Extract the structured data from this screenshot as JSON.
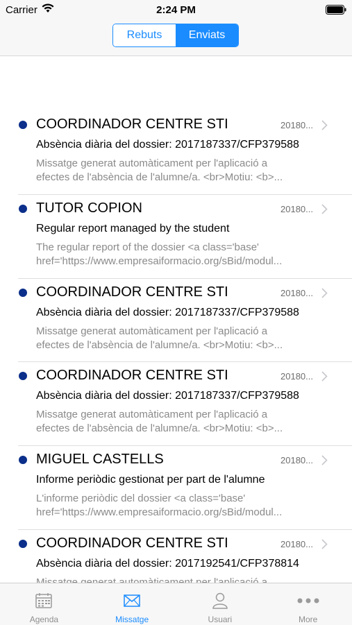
{
  "status_bar": {
    "carrier": "Carrier",
    "time": "2:24 PM"
  },
  "segments": [
    {
      "label": "Rebuts",
      "active": false
    },
    {
      "label": "Enviats",
      "active": true
    }
  ],
  "messages": [
    {
      "sender": "COORDINADOR CENTRE STI",
      "date": "20180...",
      "subject": "Absència diària del dossier: 2017187337/CFP379588",
      "preview_line1": "Missatge generat automàticament per l'aplicació a",
      "preview_line2": "efectes de l'absència de l'alumne/a. <br>Motiu: <b>..."
    },
    {
      "sender": "TUTOR COPION",
      "date": "20180...",
      "subject": "Regular report managed by the student",
      "preview_line1": "The regular report of the dossier <a class='base'",
      "preview_line2": "href='https://www.empresaiformacio.org/sBid/modul..."
    },
    {
      "sender": "COORDINADOR CENTRE STI",
      "date": "20180...",
      "subject": "Absència diària del dossier: 2017187337/CFP379588",
      "preview_line1": "Missatge generat automàticament per l'aplicació a",
      "preview_line2": "efectes de l'absència de l'alumne/a. <br>Motiu: <b>..."
    },
    {
      "sender": "COORDINADOR CENTRE STI",
      "date": "20180...",
      "subject": "Absència diària del dossier: 2017187337/CFP379588",
      "preview_line1": "Missatge generat automàticament per l'aplicació a",
      "preview_line2": "efectes de l'absència de l'alumne/a. <br>Motiu: <b>..."
    },
    {
      "sender": "MIGUEL CASTELLS",
      "date": "20180...",
      "subject": "Informe periòdic gestionat per part de l'alumne",
      "preview_line1": "L'informe periòdic del dossier <a class='base'",
      "preview_line2": "href='https://www.empresaiformacio.org/sBid/modul..."
    },
    {
      "sender": "COORDINADOR CENTRE STI",
      "date": "20180...",
      "subject": "Absència diària del dossier: 2017192541/CFP378814",
      "preview_line1": "Missatge generat automàticament per l'aplicació a",
      "preview_line2": ""
    }
  ],
  "tabs": [
    {
      "label": "Agenda",
      "icon": "calendar-icon",
      "active": false
    },
    {
      "label": "Missatge",
      "icon": "envelope-icon",
      "active": true
    },
    {
      "label": "Usuari",
      "icon": "user-icon",
      "active": false
    },
    {
      "label": "More",
      "icon": "more-icon",
      "active": false
    }
  ],
  "colors": {
    "accent": "#1a8cff",
    "unread_dot": "#0b2f8a"
  }
}
